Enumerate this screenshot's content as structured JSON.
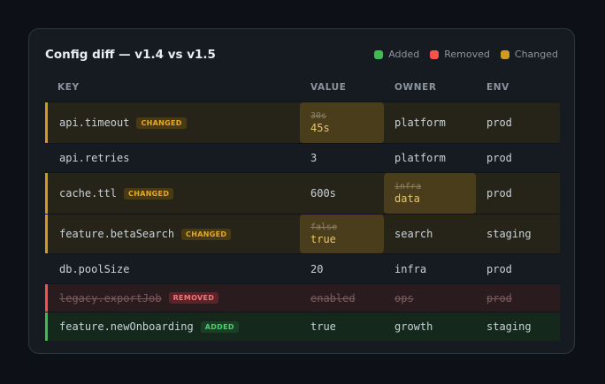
{
  "title": "Config diff — v1.4 vs v1.5",
  "legend": [
    {
      "label": "Added",
      "color": "#3fb950"
    },
    {
      "label": "Removed",
      "color": "#f85149"
    },
    {
      "label": "Changed",
      "color": "#d29922"
    }
  ],
  "columns": {
    "key": "KEY",
    "value": "VALUE",
    "owner": "OWNER",
    "env": "ENV"
  },
  "badges": {
    "changed": "CHANGED",
    "removed": "REMOVED",
    "added": "ADDED"
  },
  "rows": [
    {
      "key": "api.timeout",
      "status": "changed",
      "value_old": "30s",
      "value": "45s",
      "owner": "platform",
      "env": "prod"
    },
    {
      "key": "api.retries",
      "status": "none",
      "value": "3",
      "owner": "platform",
      "env": "prod"
    },
    {
      "key": "cache.ttl",
      "status": "changed",
      "value": "600s",
      "owner_old": "infra",
      "owner": "data",
      "env": "prod"
    },
    {
      "key": "feature.betaSearch",
      "status": "changed",
      "value_old": "false",
      "value": "true",
      "owner": "search",
      "env": "staging"
    },
    {
      "key": "db.poolSize",
      "status": "none",
      "value": "20",
      "owner": "infra",
      "env": "prod"
    },
    {
      "key": "legacy.exportJob",
      "status": "removed",
      "value": "enabled",
      "owner": "ops",
      "env": "prod"
    },
    {
      "key": "feature.newOnboarding",
      "status": "added",
      "value": "true",
      "owner": "growth",
      "env": "staging"
    }
  ],
  "colors": {
    "added": "#3fb950",
    "removed": "#f85149",
    "changed": "#d29922"
  }
}
